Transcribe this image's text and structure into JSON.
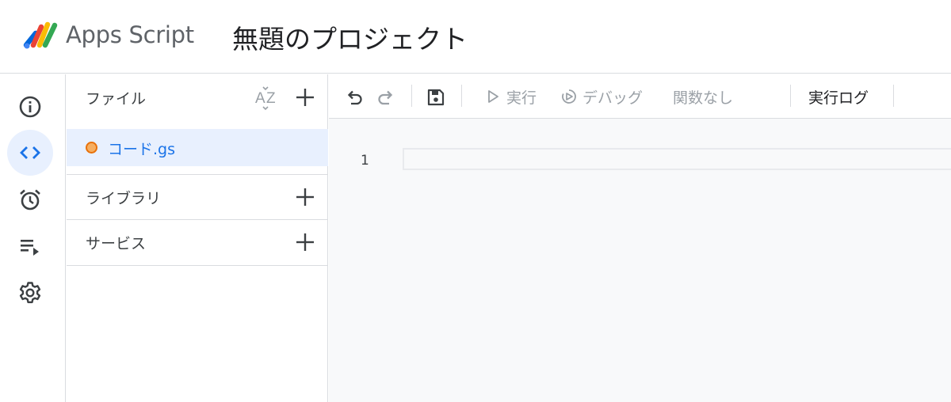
{
  "header": {
    "product_name": "Apps Script",
    "project_title": "無題のプロジェクト"
  },
  "rail": {
    "items": [
      {
        "icon": "info-icon",
        "label": "概要",
        "active": false
      },
      {
        "icon": "code-icon",
        "label": "エディタ",
        "active": true
      },
      {
        "icon": "alarm-clock-icon",
        "label": "トリガー",
        "active": false
      },
      {
        "icon": "playlist-play-icon",
        "label": "実行数",
        "active": false
      },
      {
        "icon": "gear-icon",
        "label": "プロジェクトの設定",
        "active": false
      }
    ]
  },
  "files_panel": {
    "title": "ファイル",
    "sort_icon": "sort-az-icon",
    "add_icon": "plus-icon",
    "files": [
      {
        "name": "コード.gs",
        "selected": true
      }
    ],
    "sections": [
      {
        "title": "ライブラリ"
      },
      {
        "title": "サービス"
      }
    ]
  },
  "toolbar": {
    "undo_icon": "undo-icon",
    "redo_icon": "redo-icon",
    "save_icon": "save-icon",
    "run_label": "実行",
    "debug_label": "デバッグ",
    "function_select": "関数なし",
    "log_label": "実行ログ"
  },
  "editor": {
    "line_numbers": [
      "1"
    ]
  },
  "colors": {
    "accent": "#1a73e8",
    "active_bg": "#e8f0fe",
    "divider": "#dadce0",
    "disabled_text": "#9aa0a6",
    "file_dot": "#e8710a"
  }
}
